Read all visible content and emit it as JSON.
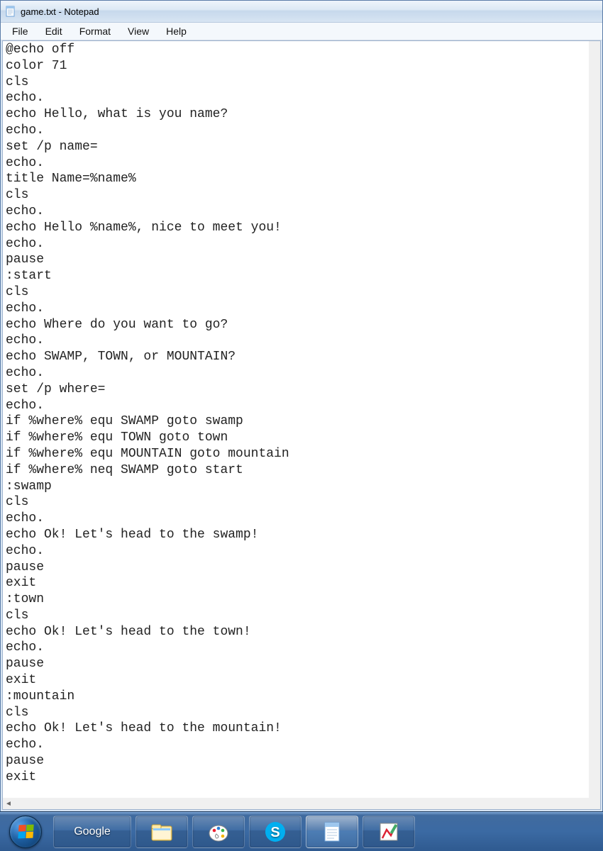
{
  "window": {
    "title": "game.txt - Notepad"
  },
  "menu": {
    "file": "File",
    "edit": "Edit",
    "format": "Format",
    "view": "View",
    "help": "Help"
  },
  "editor": {
    "content": "@echo off\ncolor 71\ncls\necho.\necho Hello, what is you name?\necho.\nset /p name=\necho.\ntitle Name=%name%\ncls\necho.\necho Hello %name%, nice to meet you!\necho.\npause\n:start\ncls\necho.\necho Where do you want to go?\necho.\necho SWAMP, TOWN, or MOUNTAIN?\necho.\nset /p where=\necho.\nif %where% equ SWAMP goto swamp\nif %where% equ TOWN goto town\nif %where% equ MOUNTAIN goto mountain\nif %where% neq SWAMP goto start\n:swamp\ncls\necho.\necho Ok! Let's head to the swamp!\necho.\npause\nexit\n:town\ncls\necho Ok! Let's head to the town!\necho.\npause\nexit\n:mountain\ncls\necho Ok! Let's head to the mountain!\necho.\npause\nexit"
  },
  "taskbar": {
    "google": "Google"
  }
}
